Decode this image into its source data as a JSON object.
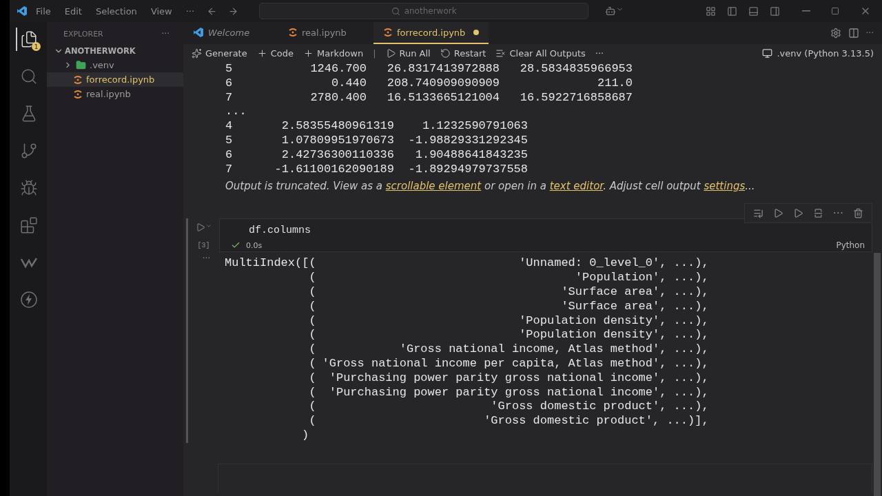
{
  "menu": [
    "File",
    "Edit",
    "Selection",
    "View",
    "···"
  ],
  "search": {
    "value": "anotherwork"
  },
  "activity_bar": [
    {
      "kind": "files",
      "selected": true,
      "badge": "1"
    },
    {
      "kind": "search",
      "selected": false
    },
    {
      "kind": "testing",
      "selected": false
    },
    {
      "kind": "source-control",
      "selected": false
    },
    {
      "kind": "run",
      "selected": false
    },
    {
      "kind": "extensions",
      "selected": false
    },
    {
      "kind": "wave",
      "selected": false
    },
    {
      "kind": "bolt",
      "selected": false
    }
  ],
  "explorer": {
    "title": "EXPLORER",
    "more": "···",
    "folder": {
      "name": "ANOTHERWORK",
      "expanded": true,
      "children": [
        {
          "name": ".venv",
          "kind": "folder",
          "expanded": false,
          "selected": false,
          "modified": false
        },
        {
          "name": "forrecord.ipynb",
          "kind": "notebook",
          "selected": true,
          "modified": true
        },
        {
          "name": "real.ipynb",
          "kind": "notebook",
          "selected": false,
          "modified": false
        }
      ]
    }
  },
  "tabs": [
    {
      "label": "Welcome",
      "kind": "welcome",
      "selected": false,
      "modified": false,
      "preview": true
    },
    {
      "label": "real.ipynb",
      "kind": "notebook",
      "selected": false,
      "modified": false,
      "preview": false
    },
    {
      "label": "forrecord.ipynb",
      "kind": "notebook",
      "selected": true,
      "modified": true,
      "preview": false
    }
  ],
  "tab_actions_more": "···",
  "toolbar": [
    {
      "kind": "generate",
      "label": "Generate"
    },
    {
      "kind": "add",
      "label": "Code"
    },
    {
      "kind": "add",
      "label": "Markdown"
    },
    {
      "kind": "separator",
      "label": "|"
    },
    {
      "kind": "run",
      "label": "Run All"
    },
    {
      "kind": "restart",
      "label": "Restart"
    },
    {
      "kind": "clear",
      "label": "Clear All Outputs"
    },
    {
      "kind": "more",
      "label": "···"
    }
  ],
  "kernel": ".venv (Python 3.13.5)",
  "previous_output": {
    "rows_a": [
      [
        "5",
        "1246.700",
        "26.8317413972888",
        "28.5834835966953"
      ],
      [
        "6",
        "0.440",
        "208.740909090909",
        "211.0"
      ],
      [
        "7",
        "2780.400",
        "16.5133665121004",
        "16.5922716858687"
      ]
    ],
    "ellipsis": "...",
    "rows_b": [
      [
        "4",
        "2.58355480961319",
        "1.1232590791063"
      ],
      [
        "5",
        "1.07809951970673",
        "-1.98829331292345"
      ],
      [
        "6",
        "2.42736300110336",
        "1.90488641843235"
      ],
      [
        "7",
        "-1.61100162090189",
        "-1.89294979737558"
      ]
    ],
    "notice": [
      {
        "kind": "text",
        "text": "Output is truncated. View as a "
      },
      {
        "kind": "link",
        "text": "scrollable element"
      },
      {
        "kind": "text",
        "text": " or open in a "
      },
      {
        "kind": "link",
        "text": "text editor"
      },
      {
        "kind": "text",
        "text": ". Adjust cell output "
      },
      {
        "kind": "link",
        "text": "settings"
      },
      {
        "kind": "text",
        "text": "..."
      }
    ]
  },
  "cell": {
    "code": "df.columns",
    "execution_count": "[3]",
    "succeeded": true,
    "duration": "0.0s",
    "language": "Python",
    "focused": true,
    "more": "···",
    "output_more": "···",
    "output": [
      [
        "MultiIndex([(",
        "'Unnamed: 0_level_0', ...),"
      ],
      [
        "(",
        "'Population', ...),"
      ],
      [
        "(",
        "'Surface area', ...),"
      ],
      [
        "(",
        "'Surface area', ...),"
      ],
      [
        "(",
        "'Population density', ...),"
      ],
      [
        "(",
        "'Population density', ...),"
      ],
      [
        "(",
        "'Gross national income, Atlas method', ...),"
      ],
      [
        "(",
        "'Gross national income per capita, Atlas method', ...),"
      ],
      [
        "(",
        "'Purchasing power parity gross national income', ...),"
      ],
      [
        "(",
        "'Purchasing power parity gross national income', ...),"
      ],
      [
        "(",
        "'Gross domestic product', ...),"
      ],
      [
        "(",
        "'Gross domestic product', ...)],"
      ]
    ],
    "output_close": ")"
  }
}
